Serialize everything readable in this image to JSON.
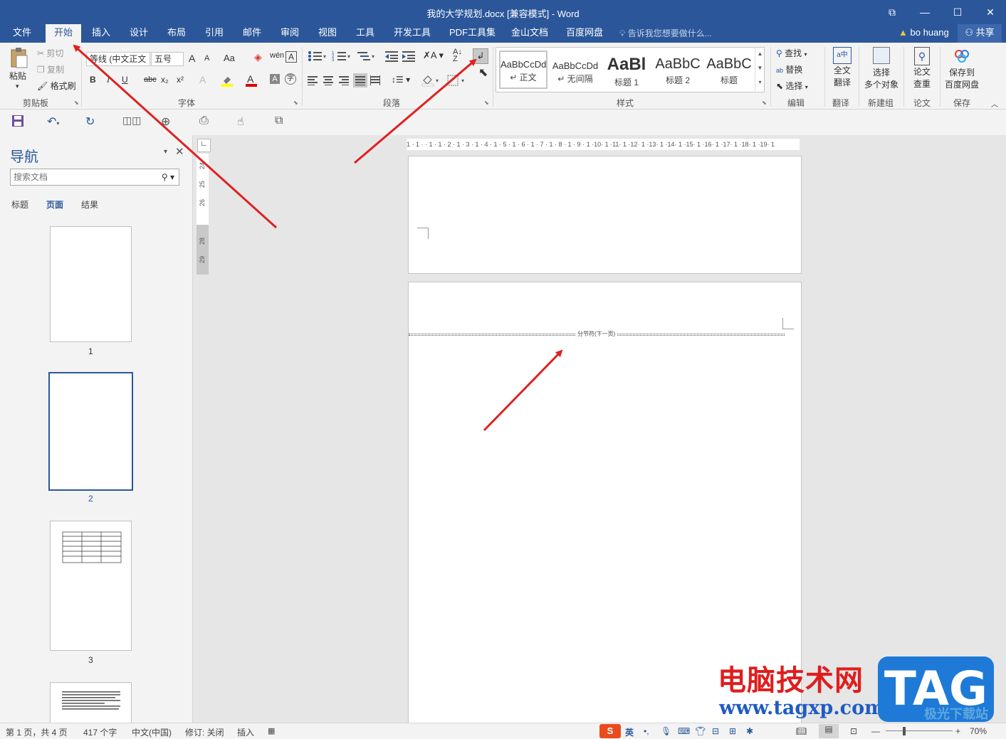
{
  "window": {
    "title": "我的大学规划.docx [兼容模式] - Word",
    "controls": {
      "ribbon_display": "⧉",
      "minimize": "—",
      "maximize": "☐",
      "close": "✕"
    }
  },
  "menu": {
    "tabs": [
      "文件",
      "开始",
      "插入",
      "设计",
      "布局",
      "引用",
      "邮件",
      "审阅",
      "视图",
      "工具",
      "开发工具",
      "PDF工具集",
      "金山文档",
      "百度网盘"
    ],
    "active": "开始",
    "tell_me": "告诉我您想要做什么...",
    "user": "bo huang",
    "share": "共享"
  },
  "ribbon": {
    "clipboard": {
      "paste": "粘贴",
      "cut": "剪切",
      "copy": "复制",
      "format_painter": "格式刷",
      "label": "剪贴板"
    },
    "font": {
      "name": "等线 (中文正文",
      "size": "五号",
      "grow": "A",
      "shrink": "A",
      "case": "Aa",
      "bold": "B",
      "italic": "I",
      "underline": "U",
      "strike": "abc",
      "sub": "x₂",
      "sup": "x²",
      "label": "字体"
    },
    "paragraph": {
      "label": "段落"
    },
    "styles": {
      "items": [
        {
          "sample": "AaBbCcDd",
          "name": "↵ 正文"
        },
        {
          "sample": "AaBbCcDd",
          "name": "↵ 无间隔"
        },
        {
          "sample": "AaBl",
          "name": "标题 1"
        },
        {
          "sample": "AaBbC",
          "name": "标题 2"
        },
        {
          "sample": "AaBbC",
          "name": "标题"
        }
      ],
      "label": "样式"
    },
    "editing": {
      "find": "查找",
      "replace": "替换",
      "select": "选择",
      "label": "编辑"
    },
    "translate": {
      "btn_line1": "全文",
      "btn_line2": "翻译",
      "label": "翻译"
    },
    "newgroup": {
      "btn_line1": "选择",
      "btn_line2": "多个对象",
      "label": "新建组"
    },
    "paper": {
      "btn_line1": "论文",
      "btn_line2": "查重",
      "label": "论文"
    },
    "save": {
      "btn_line1": "保存到",
      "btn_line2": "百度网盘",
      "label": "保存"
    }
  },
  "nav": {
    "title": "导航",
    "search_placeholder": "搜索文档",
    "tabs": [
      "标题",
      "页面",
      "结果"
    ],
    "active_tab": "页面",
    "pages": [
      "1",
      "2",
      "3"
    ]
  },
  "document": {
    "section_break": "分节符(下一页)",
    "hruler": "1 · 1 ·   · 1 · 1 · 2 · 1 · 3 · 1 · 4 · 1 · 5 · 1 · 6 · 1 · 7 · 1 · 8 · 1 · 9 · 1 ·10· 1 ·11· 1 ·12· 1 ·13· 1 ·14· 1 ·15· 1 ·16· 1 ·17· 1 ·18· 1 ·19· 1",
    "vruler": [
      "24",
      "25",
      "26",
      "28",
      "29"
    ]
  },
  "status": {
    "page": "第 1 页，共 4 页",
    "words": "417 个字",
    "lang": "中文(中国)",
    "track": "修订: 关闭",
    "insert": "插入",
    "ime": "英",
    "zoom": "70%"
  },
  "watermark": {
    "text": "电脑技术网",
    "url": "www.tagxp.com",
    "tag": "TAG",
    "sub": "极光下载站"
  },
  "colors": {
    "accent": "#2b579a",
    "arrow": "#e02020"
  }
}
